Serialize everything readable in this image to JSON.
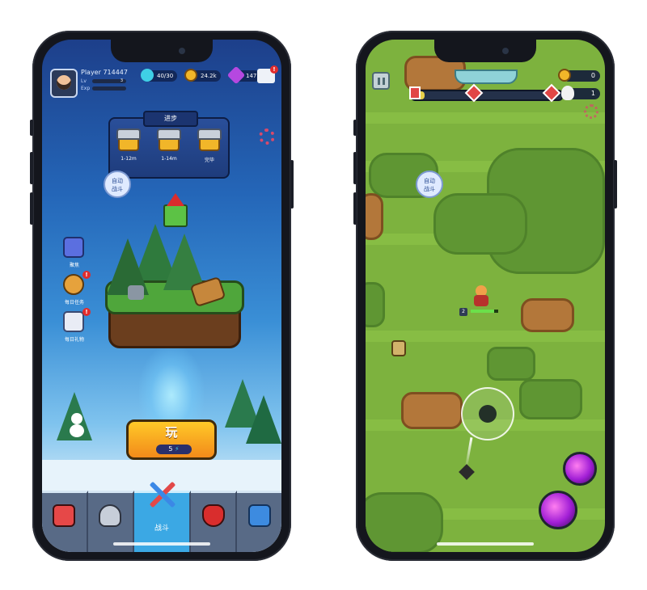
{
  "left_phone": {
    "player": {
      "name": "Player 714447",
      "lv_label": "Lv",
      "lv_value": "3",
      "exp_label": "Exp"
    },
    "resources": {
      "energy": "40/30",
      "coins": "24.2k",
      "gems": "147"
    },
    "progress": {
      "title": "进步",
      "chests": [
        {
          "label": "1-12m"
        },
        {
          "label": "1-14m"
        },
        {
          "label": "完毕"
        }
      ]
    },
    "auto_button": {
      "line1": "自动",
      "line2": "战斗"
    },
    "side_menu": [
      {
        "label": "聚焦",
        "icon": "screen-icon",
        "badge": ""
      },
      {
        "label": "每日任务",
        "icon": "camera-icon",
        "badge": "!"
      },
      {
        "label": "每日礼物",
        "icon": "gift-calendar-icon",
        "badge": "!"
      }
    ],
    "play_button": {
      "label": "玩",
      "cost": "5"
    },
    "nav": [
      {
        "label": "",
        "icon": "shop-icon"
      },
      {
        "label": "",
        "icon": "helmet-icon"
      },
      {
        "label": "战斗",
        "icon": "crossed-swords-icon",
        "active": true
      },
      {
        "label": "",
        "icon": "mask-icon"
      },
      {
        "label": "",
        "icon": "cards-icon"
      }
    ],
    "mail_badge": "!",
    "colors": {
      "accent": "#f28a1a",
      "sky": "#2466b8",
      "active_tab": "#3ba8e4"
    }
  },
  "right_phone": {
    "coins": "0",
    "kills": "1",
    "level": "2",
    "auto_button": {
      "line1": "自动",
      "line2": "战斗"
    },
    "colors": {
      "grass": "#7db23e",
      "skill": "#a21fd6"
    }
  }
}
